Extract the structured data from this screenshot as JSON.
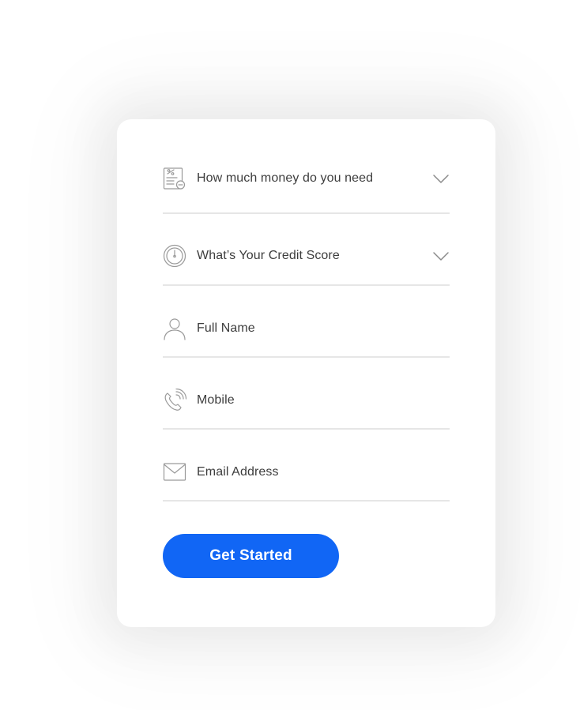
{
  "form": {
    "fields": [
      {
        "label": "How much money do you need",
        "icon": "loan-percent-icon",
        "has_dropdown": true
      },
      {
        "label": "What’s Your Credit Score",
        "icon": "gauge-icon",
        "has_dropdown": true
      },
      {
        "label": "Full Name",
        "icon": "user-icon",
        "has_dropdown": false
      },
      {
        "label": "Mobile",
        "icon": "phone-icon",
        "has_dropdown": false
      },
      {
        "label": "Email Address",
        "icon": "envelope-icon",
        "has_dropdown": false
      }
    ],
    "submit_label": "Get Started"
  },
  "colors": {
    "accent": "#1166f5",
    "text": "#3d3d3d",
    "icon": "#9a9a9a",
    "divider": "#e6e6e6"
  }
}
